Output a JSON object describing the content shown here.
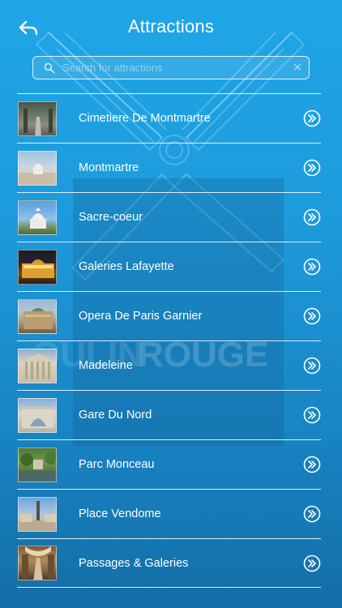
{
  "header": {
    "title": "Attractions",
    "back_icon": "back-arrow-icon"
  },
  "search": {
    "placeholder": "Search for attractions",
    "value": "",
    "search_icon": "search-icon",
    "clear_icon": "clear-icon",
    "clear_glyph": "✕"
  },
  "colors": {
    "background_top": "#1fa6e6",
    "background_bottom": "#136ea7",
    "foreground": "#ffffff"
  },
  "attractions": [
    {
      "label": "Cimetiere De Montmartre",
      "thumb": "cemetery-alley"
    },
    {
      "label": "Montmartre",
      "thumb": "hilltop-city"
    },
    {
      "label": "Sacre-coeur",
      "thumb": "white-basilica"
    },
    {
      "label": "Galeries Lafayette",
      "thumb": "lit-department-store"
    },
    {
      "label": "Opera De Paris Garnier",
      "thumb": "opera-facade"
    },
    {
      "label": "Madeleine",
      "thumb": "columned-temple"
    },
    {
      "label": "Gare Du Nord",
      "thumb": "station-facade"
    },
    {
      "label": "Parc Monceau",
      "thumb": "park-pond"
    },
    {
      "label": "Place Vendome",
      "thumb": "square-column"
    },
    {
      "label": "Passages & Galeries",
      "thumb": "covered-arcade"
    }
  ]
}
